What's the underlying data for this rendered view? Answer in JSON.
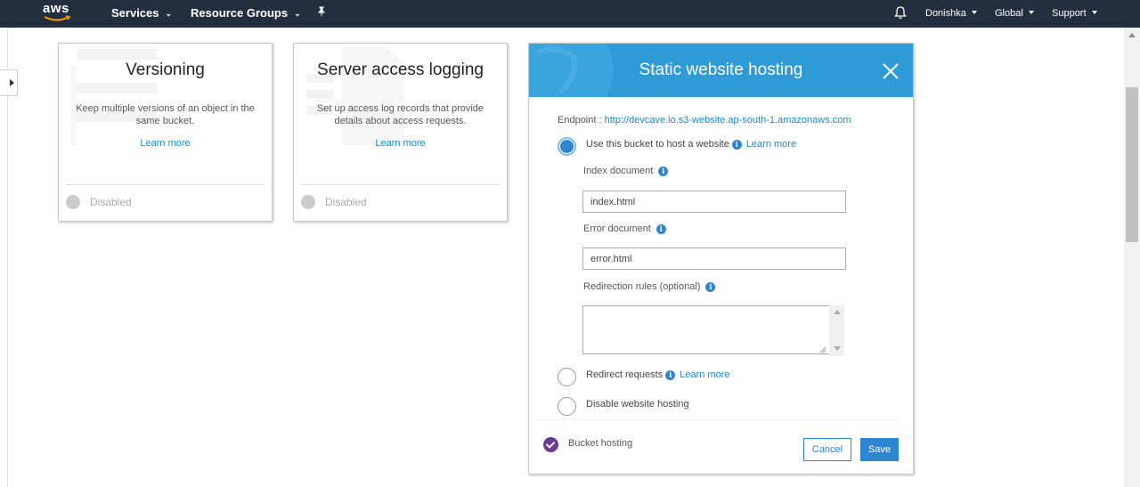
{
  "nav": {
    "logo_text": "aws",
    "services_label": "Services",
    "resource_groups_label": "Resource Groups",
    "user_label": "Donishka",
    "region_label": "Global",
    "support_label": "Support"
  },
  "cards": [
    {
      "title": "Versioning",
      "description": "Keep multiple versions of an object in the same bucket.",
      "learn_more": "Learn more",
      "status": "Disabled"
    },
    {
      "title": "Server access logging",
      "description": "Set up access log records that provide details about access requests.",
      "learn_more": "Learn more",
      "status": "Disabled"
    }
  ],
  "modal": {
    "title": "Static website hosting",
    "endpoint_label": "Endpoint : ",
    "endpoint_url": "http://devcave.io.s3-website.ap-south-1.amazonaws.com",
    "option_host": "Use this bucket to host a website",
    "option_host_learn": "Learn more",
    "index_label": "Index document",
    "index_value": "index.html",
    "error_label": "Error document",
    "error_value": "error.html",
    "redirection_label": "Redirection rules (optional)",
    "redirection_value": "",
    "option_redirect": "Redirect requests",
    "option_redirect_learn": "Learn more",
    "option_disable": "Disable website hosting",
    "footer_status": "Bucket hosting",
    "cancel_label": "Cancel",
    "save_label": "Save",
    "selected_option": "host"
  },
  "colors": {
    "nav_bg": "#232f3e",
    "accent": "#2e86d0",
    "header_bg": "#2e9bd6",
    "check": "#6b3a93"
  },
  "icons": [
    "bell-icon",
    "pin-icon",
    "info-icon",
    "close-icon",
    "checkmark-icon"
  ]
}
